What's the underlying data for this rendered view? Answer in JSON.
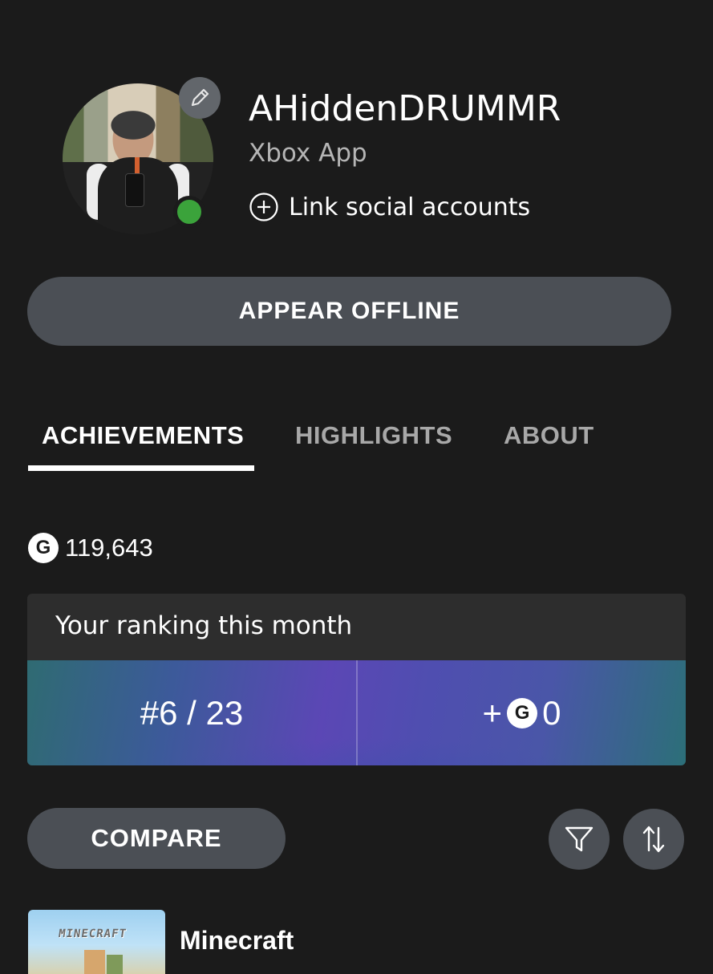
{
  "profile": {
    "gamertag": "AHiddenDRUMMR",
    "app_label": "Xbox App",
    "link_social_label": "Link social accounts",
    "presence_color": "#3ba33b"
  },
  "actions": {
    "appear_offline_label": "APPEAR OFFLINE"
  },
  "tabs": [
    {
      "label": "ACHIEVEMENTS",
      "selected": true
    },
    {
      "label": "HIGHLIGHTS",
      "selected": false
    },
    {
      "label": "ABOUT",
      "selected": false
    }
  ],
  "gamerscore": {
    "badge": "G",
    "value": "119,643"
  },
  "ranking": {
    "title": "Your ranking this month",
    "position": "#6 / 23",
    "gain_prefix": "+",
    "gain_badge": "G",
    "gain_value": "0"
  },
  "toolbar": {
    "compare_label": "COMPARE",
    "filter_icon": "filter-icon",
    "sort_icon": "sort-icon"
  },
  "games": [
    {
      "title": "Minecraft",
      "logo_text": "MINECRAFT"
    }
  ],
  "colors": {
    "background": "#1b1b1b",
    "button": "#4b4f55",
    "muted_text": "#a8a8a8"
  }
}
